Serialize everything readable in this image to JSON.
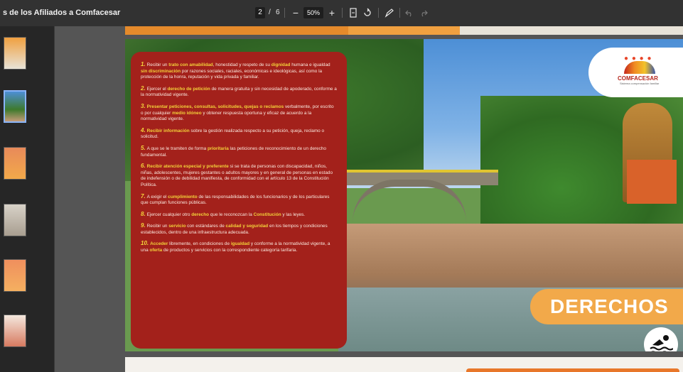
{
  "toolbar": {
    "title": "s de los Afiliados a Comfacesar",
    "page_current": "2",
    "page_sep": "/",
    "page_total": "6",
    "zoom": "50%",
    "zoom_out": "−",
    "zoom_in": "+"
  },
  "sidebar": {
    "thumbnails": [
      "1",
      "2",
      "3",
      "4",
      "5",
      "6"
    ],
    "active": "2"
  },
  "slide": {
    "logo_name": "COMFACESAR",
    "logo_tagline": "Sistema compensación familiar",
    "heading": "DERECHOS",
    "rights": [
      {
        "num": "1.",
        "parts": [
          [
            "",
            "Recibir un "
          ],
          [
            "hl",
            "trato con amabilidad"
          ],
          [
            "",
            ", honestidad y respeto de su "
          ],
          [
            "hl",
            "dignidad"
          ],
          [
            "",
            " humana e igualdad "
          ],
          [
            "hl",
            "sin discriminación"
          ],
          [
            "",
            " por razones sociales, raciales, económicas e ideológicas, así como la protección de la honra, reputación y vida privada y familiar."
          ]
        ]
      },
      {
        "num": "2.",
        "parts": [
          [
            "",
            "Ejercer el "
          ],
          [
            "hl",
            "derecho de petición"
          ],
          [
            "",
            " de manera gratuita y sin necesidad de apoderado, conforme a la normatividad vigente."
          ]
        ]
      },
      {
        "num": "3.",
        "parts": [
          [
            "hl",
            "Presentar peticiones, consultas, solicitudes, quejas o reclamos"
          ],
          [
            "",
            " verbalmente, por escrito o por cualquier "
          ],
          [
            "hl",
            "medio idóneo"
          ],
          [
            "",
            " y obtener respuesta oportuna y eficaz de acuerdo a la normatividad vigente."
          ]
        ]
      },
      {
        "num": "4.",
        "parts": [
          [
            "hl",
            "Recibir información"
          ],
          [
            "",
            " sobre la gestión realizada respecto a su petición, queja, reclamo o solicitud."
          ]
        ]
      },
      {
        "num": "5.",
        "parts": [
          [
            "",
            "A que se le tramiten de forma "
          ],
          [
            "hl",
            "prioritaria"
          ],
          [
            "",
            " las peticiones de reconocimiento de un derecho fundamental."
          ]
        ]
      },
      {
        "num": "6.",
        "parts": [
          [
            "hl",
            "Recibir atención especial y preferente"
          ],
          [
            "",
            " si se trata de personas con discapacidad, niños, niñas, adolescentes, mujeres gestantes o adultos mayores y en general de personas en estado de indefensión o de debilidad manifiesta, de conformidad con el artículo 13 de la Constitución Política."
          ]
        ]
      },
      {
        "num": "7.",
        "parts": [
          [
            "",
            "A exigir el "
          ],
          [
            "hl",
            "cumplimiento"
          ],
          [
            "",
            " de las responsabilidades de los funcionarios y de los particulares que cumplan funciones públicas."
          ]
        ]
      },
      {
        "num": "8.",
        "parts": [
          [
            "",
            "Ejercer cualquier otro "
          ],
          [
            "hl",
            "derecho"
          ],
          [
            "",
            " que le reconozcan la "
          ],
          [
            "hl",
            "Constitución"
          ],
          [
            "",
            " y las leyes."
          ]
        ]
      },
      {
        "num": "9.",
        "parts": [
          [
            "",
            "Recibir un "
          ],
          [
            "hl",
            "servicio"
          ],
          [
            "",
            " con estándares de "
          ],
          [
            "hl",
            "calidad y seguridad"
          ],
          [
            "",
            " en los tiempos y condiciones establecidos, dentro de una infraestructura adecuada."
          ]
        ]
      },
      {
        "num": "10.",
        "parts": [
          [
            "hl",
            "Acceder"
          ],
          [
            "",
            " libremente, en condiciones de "
          ],
          [
            "hl",
            "igualdad"
          ],
          [
            "",
            " y conforme a la normatividad vigente, a una "
          ],
          [
            "hl",
            "oferta"
          ],
          [
            "",
            " de productos y servicios con la correspondiente categoría tarifaria."
          ]
        ]
      }
    ]
  },
  "icons": {
    "zoom_out": "minus-icon",
    "zoom_in": "plus-icon",
    "fit": "fit-page-icon",
    "rotate": "rotate-icon",
    "annotate": "draw-icon",
    "undo": "undo-icon",
    "redo": "redo-icon",
    "swim": "swimmer-icon"
  },
  "colors": {
    "toolbar_bg": "#323232",
    "rights_box": "#a3211b",
    "highlight": "#f3d23a",
    "derechos_band": "#f2a94a"
  }
}
